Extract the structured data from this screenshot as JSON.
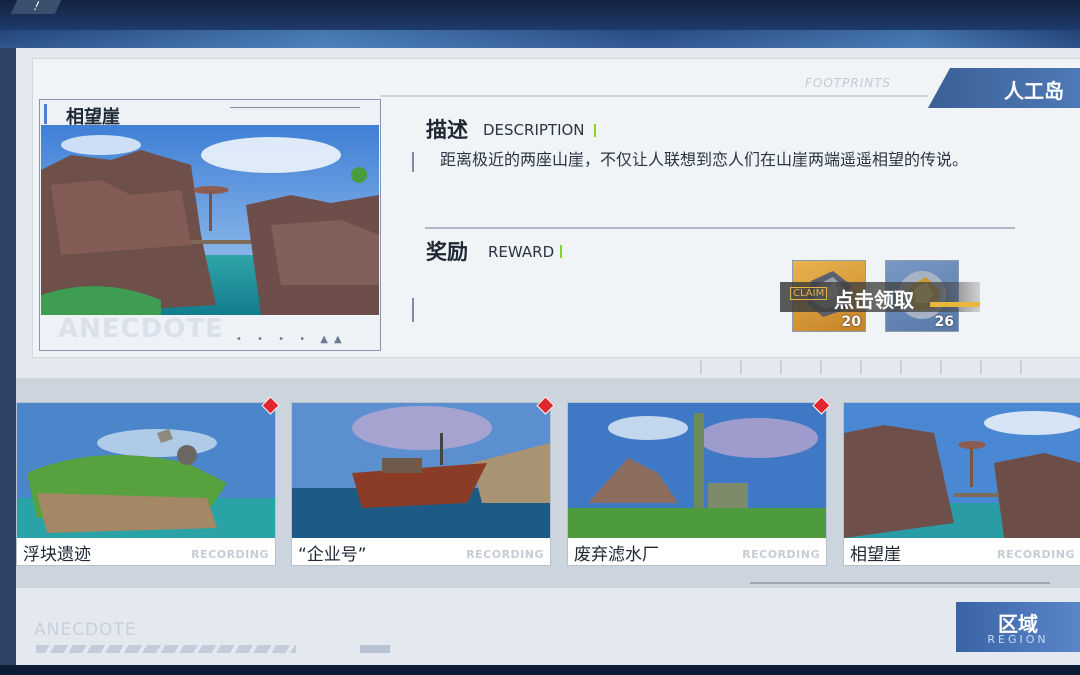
{
  "top": {
    "menu_icon": "!"
  },
  "header": {
    "footprints": "FOOTPRINTS",
    "island_name": "人工岛"
  },
  "detail": {
    "photo_title": "相望崖",
    "photo_watermark": "ANECDOTE",
    "description_title": "描述",
    "description_title_en": "DESCRIPTION",
    "description_text": "距离极近的两座山崖，不仅让人联想到恋人们在山崖两端遥遥相望的传说。",
    "reward_title": "奖励",
    "reward_title_en": "REWARD",
    "rewards": [
      {
        "icon": "silver-ore-icon",
        "count": "20"
      },
      {
        "icon": "gold-ore-icon",
        "count": "26"
      }
    ],
    "claim_small": "CLAIM",
    "claim_label": "点击领取"
  },
  "records": [
    {
      "name": "浮块遗迹",
      "tag": "RECORDING",
      "new": true
    },
    {
      "name": "“企业号”",
      "tag": "RECORDING",
      "new": true
    },
    {
      "name": "废弃滤水厂",
      "tag": "RECORDING",
      "new": true
    },
    {
      "name": "相望崖",
      "tag": "RECORDING",
      "new": false
    }
  ],
  "footer": {
    "watermark": "ANECDOTE",
    "region_label": "区域",
    "region_label_en": "REGION"
  },
  "colors": {
    "accent_blue": "#3b5f95",
    "new_badge": "#e2262e",
    "claim_gold": "#e8b83d",
    "green_mark": "#8bd22b"
  }
}
